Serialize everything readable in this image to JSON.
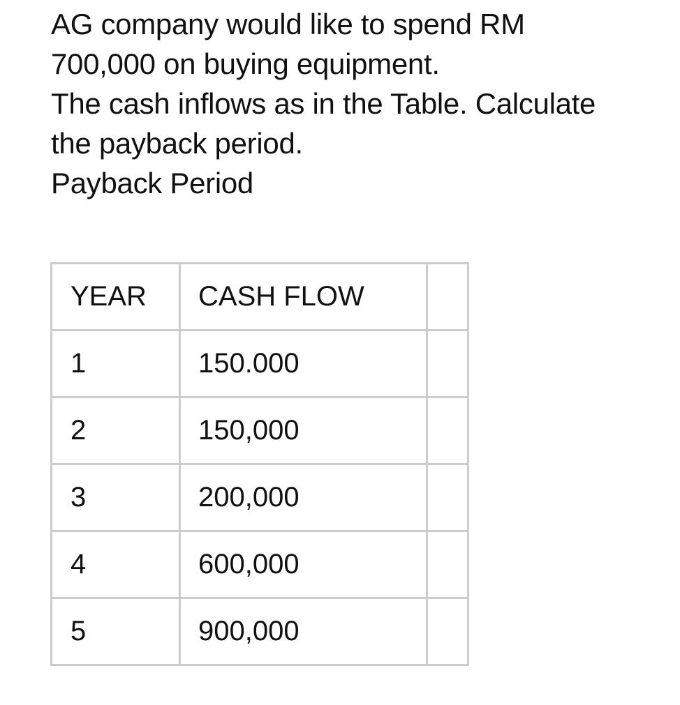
{
  "question": {
    "lines": [
      "AG company would like to spend RM",
      "700,000 on buying equipment.",
      "The cash inflows as in the Table. Calculate",
      "the payback period.",
      "Payback Period"
    ]
  },
  "table": {
    "headers": [
      "YEAR",
      "CASH FLOW",
      ""
    ],
    "rows": [
      {
        "year": "1",
        "cash_flow": "150.000",
        "extra": ""
      },
      {
        "year": "2",
        "cash_flow": "150,000",
        "extra": ""
      },
      {
        "year": "3",
        "cash_flow": "200,000",
        "extra": ""
      },
      {
        "year": "4",
        "cash_flow": "600,000",
        "extra": ""
      },
      {
        "year": "5",
        "cash_flow": "900,000",
        "extra": ""
      }
    ]
  }
}
